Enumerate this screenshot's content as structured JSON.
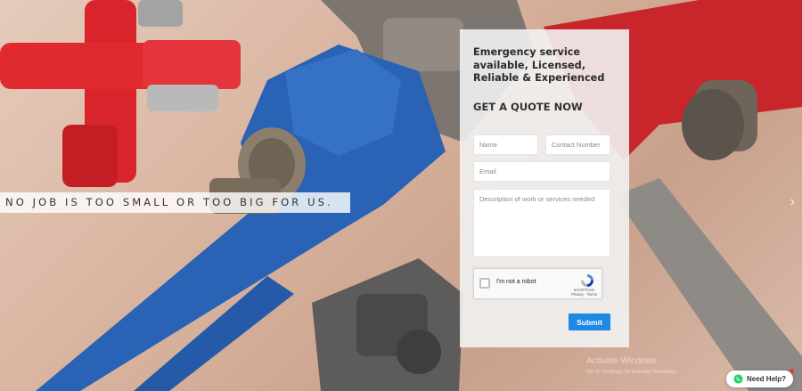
{
  "hero": {
    "tagline": "NO JOB IS TOO SMALL OR TOO BIG FOR US.",
    "next_icon": "chevron-right-icon"
  },
  "form": {
    "heading": "Emergency service available, Licensed, Reliable & Experienced",
    "subheading": "GET A QUOTE NOW",
    "name_placeholder": "Name",
    "contact_placeholder": "Contact Number",
    "email_placeholder": "Email",
    "description_placeholder": "Description of work or services needed",
    "captcha_label": "I'm not a robot",
    "captcha_brand": "reCAPTCHA",
    "captcha_links": "Privacy - Terms",
    "submit_label": "Submit",
    "accent": "#1e88e5"
  },
  "watermark": {
    "line1": "Activate Windows",
    "line2": "Go to Settings to activate Windows."
  },
  "help": {
    "label": "Need Help?",
    "icon": "whatsapp-icon"
  }
}
